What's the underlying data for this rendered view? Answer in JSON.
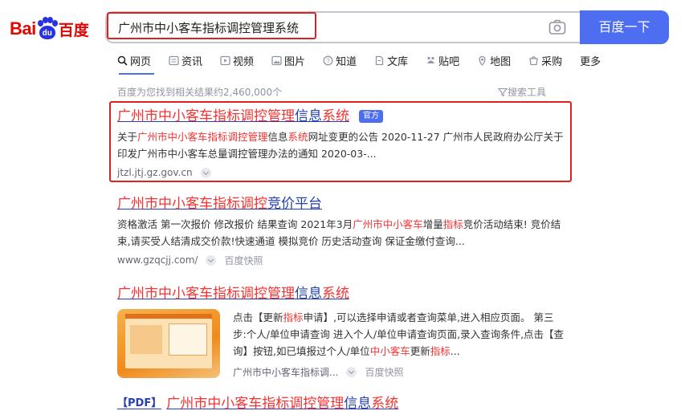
{
  "logo": {
    "bai": "Bai",
    "du": "du",
    "cn": "百度"
  },
  "search": {
    "query": "广州市中小客车指标调控管理系统",
    "button_label": "百度一下"
  },
  "tabs": [
    {
      "label": "网页",
      "icon": "search-icon"
    },
    {
      "label": "资讯",
      "icon": "news-icon"
    },
    {
      "label": "视频",
      "icon": "video-icon"
    },
    {
      "label": "图片",
      "icon": "image-icon"
    },
    {
      "label": "知道",
      "icon": "question-icon"
    },
    {
      "label": "文库",
      "icon": "document-icon"
    },
    {
      "label": "贴吧",
      "icon": "tieba-icon"
    },
    {
      "label": "地图",
      "icon": "map-icon"
    },
    {
      "label": "采购",
      "icon": "purchase-icon"
    },
    {
      "label": "更多",
      "icon": ""
    }
  ],
  "result_count": "百度为您找到相关结果约2,460,000个",
  "search_tools": "搜索工具",
  "results": [
    {
      "title_hl": "广州市中小客车指标调控管理",
      "title_a": "信息",
      "title_hl2": "系统",
      "badge": "官方",
      "abs_1": "关于",
      "abs_hl1": "广州市中小客车指标调控管理",
      "abs_2": "信息",
      "abs_hl2": "系统",
      "abs_3": "网址变更的公告 2020-11-27 广州市人民政府办公厅关于印发广州市中小客车总量调控管理办法的通知 2020-03-...",
      "source": "jtzl.jtj.gz.gov.cn"
    },
    {
      "title_hl": "广州市中小客车指标调控",
      "title_a": "竞价平台",
      "abs_1": "资格激活 第一次报价 修改报价 结果查询 2021年3月",
      "abs_hl1": "广州市中小客车",
      "abs_2": "增量",
      "abs_hl2": "指标",
      "abs_3": "竞价活动结束! 竞价结束,请买受人结清成交价款!快速通道 模拟竞价 历史活动查询 保证金缴付查询...",
      "source": "www.gzqcjj.com/",
      "snapshot": "百度快照"
    },
    {
      "title_hl": "广州市中小客车指标调控管理",
      "title_a": "信息",
      "title_hl2": "系统",
      "abs_1": "点击【更新",
      "abs_hl1": "指标",
      "abs_2": "申请】,可以选择申请或者查询菜单,进入相应页面。 第三步:个人/单位申请查询 进入个人/单位申请查询页面,录入查询条件,点击【查询】按钮,如已填报过个人/单位",
      "abs_hl2": "中小客车",
      "abs_3": "更新",
      "abs_hl3": "指标",
      "abs_4": "...",
      "source": "广州市中小客车指标调...",
      "snapshot": "百度快照"
    },
    {
      "pdf_tag": "【PDF】",
      "title_hl": "广州市中小客车指标调控管理",
      "title_a": "信息",
      "title_hl2": "系统"
    }
  ]
}
